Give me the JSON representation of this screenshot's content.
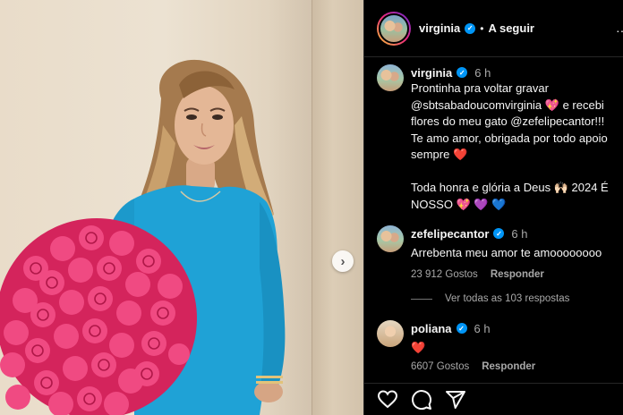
{
  "post": {
    "author": "virginia",
    "follow_label": "A seguir",
    "separator": "•",
    "caption": {
      "author": "virginia",
      "time": "6 h",
      "text": "Prontinha pra voltar gravar\n@sbtsabadoucomvirginia 💖 e recebi\nflores do meu gato @zefelipecantor!!!\nTe amo amor, obrigada por todo apoio\nsempre ❤️\n\nToda honra e glória a Deus 🙌🏻 2024 É\nNOSSO 💖 💜 💙"
    }
  },
  "comments": [
    {
      "author": "zefelipecantor",
      "time": "6 h",
      "text": "Arrebenta meu amor te amoooooooo",
      "likes": "23 912 Gostos",
      "reply_label": "Responder"
    },
    {
      "author": "poliana",
      "time": "6 h",
      "text": "❤️",
      "likes": "6607 Gostos",
      "reply_label": "Responder"
    }
  ],
  "view_replies": "Ver todas as 103 respostas",
  "icons": {
    "next": "chevron-right-icon",
    "like": "heart-icon",
    "comment": "comment-icon",
    "share": "send-icon",
    "more": "more-icon"
  },
  "colors": {
    "verified": "#0095f6",
    "dress": "#1fa2d6",
    "roses": "#e8336e",
    "background": "#000000"
  }
}
